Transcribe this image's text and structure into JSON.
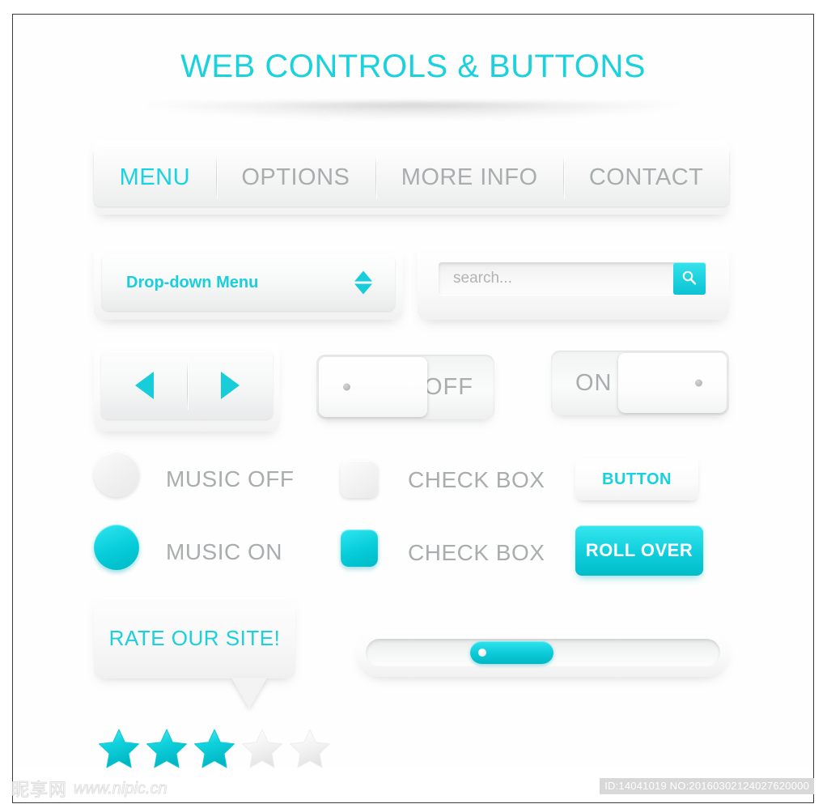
{
  "page": {
    "title": "WEB CONTROLS & BUTTONS",
    "accent_color": "#17cdd9",
    "accent_color_dark": "#00b8c5",
    "muted_color": "#a9adae",
    "background": "#ffffff"
  },
  "nav": {
    "items": [
      {
        "label": "MENU",
        "active": true
      },
      {
        "label": "OPTIONS",
        "active": false
      },
      {
        "label": "MORE INFO",
        "active": false
      },
      {
        "label": "CONTACT",
        "active": false
      }
    ]
  },
  "dropdown": {
    "label": "Drop-down Menu",
    "up_icon": "triangle-up-icon",
    "down_icon": "triangle-down-icon"
  },
  "search": {
    "value": "",
    "placeholder": "search...",
    "button_icon": "search-icon"
  },
  "arrows": {
    "prev_icon": "triangle-left-icon",
    "next_icon": "triangle-right-icon"
  },
  "toggles": [
    {
      "name": "toggle-off",
      "label": "OFF",
      "state": "off",
      "knob_position": "left"
    },
    {
      "name": "toggle-on",
      "label": "ON",
      "state": "on",
      "knob_position": "right"
    }
  ],
  "radios": [
    {
      "label": "MUSIC OFF",
      "checked": false
    },
    {
      "label": "MUSIC ON",
      "checked": true
    }
  ],
  "checkboxes": [
    {
      "label": "CHECK BOX",
      "checked": false
    },
    {
      "label": "CHECK BOX",
      "checked": true
    }
  ],
  "buttons": [
    {
      "label": "BUTTON",
      "style": "default"
    },
    {
      "label": "ROLL OVER",
      "style": "rollover"
    }
  ],
  "tooltip": {
    "text": "RATE OUR SITE!"
  },
  "rating": {
    "filled": 3,
    "total": 5
  },
  "slider": {
    "thumb_position_percent": 29,
    "thumb_width_percent": 24
  },
  "footer": {
    "watermark_cn": "昵享网",
    "watermark_url": "www.nipic.cn",
    "id_text": "ID:14041019 NO:20160302124027620000"
  }
}
